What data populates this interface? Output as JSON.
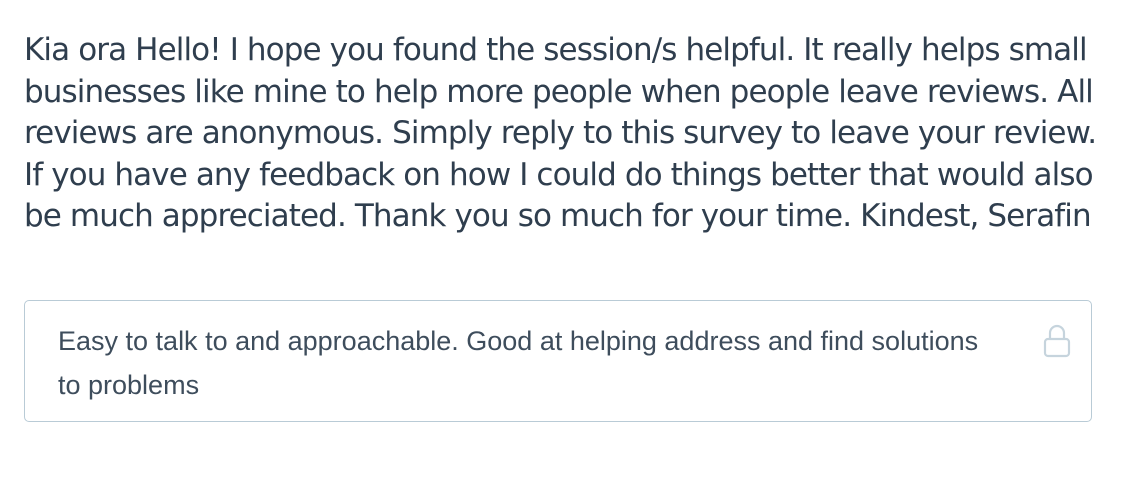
{
  "survey": {
    "question_text": "Kia ora Hello! I hope you found the session/s helpful. It really helps small businesses like mine to help more people when people leave reviews. All reviews are anonymous. Simply reply to this survey to leave your review. If you have any feedback on how I could do things better that would also be much appreciated. Thank you so much for your time. Kindest, Serafin",
    "answer_value": "Easy to talk to and approachable. Good at helping address and find solutions to problems",
    "answer_locked_icon": "lock-icon"
  },
  "colors": {
    "text": "#2f3e4e",
    "answer_text": "#3e4d5c",
    "border": "#b9cbd6",
    "icon": "#c6d4dd"
  }
}
